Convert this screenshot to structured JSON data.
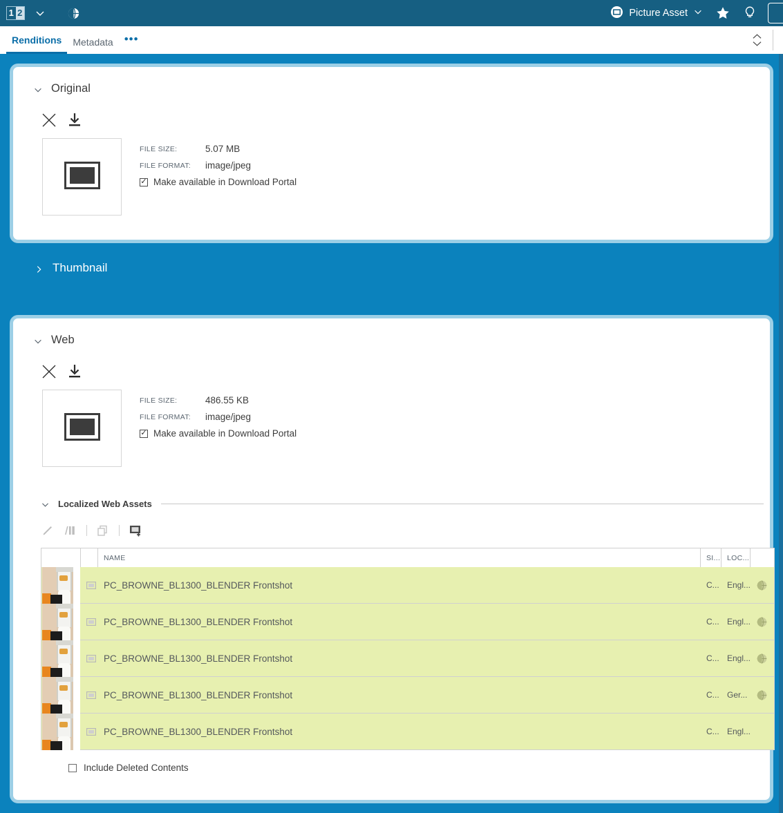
{
  "appbar": {
    "logo_first": "1",
    "logo_second": "2",
    "dropdown_icon": "chevron-down-icon",
    "globe_icon": "globe-icon",
    "asset_type_label": "Picture Asset",
    "asset_type_icon": "picture-icon",
    "asset_type_chevron": "chevron-down-icon",
    "favorite_icon": "star-icon",
    "hint_icon": "lightbulb-icon",
    "bar_color": "#165f82"
  },
  "tabs": {
    "items": [
      {
        "label": "Renditions",
        "active": true
      },
      {
        "label": "Metadata",
        "active": false
      }
    ],
    "more_label": "•••",
    "collapse_toggle_icon": "chevron-up-down-icon",
    "active_color": "#0b6ea8"
  },
  "background_color": "#0b82bd",
  "panel_border_color": "#9ccfe6",
  "renditions": {
    "original": {
      "title": "Original",
      "expanded": true,
      "chevron_icon": "chevron-down-icon",
      "delete_icon": "close-x-icon",
      "download_icon": "download-icon",
      "preview_icon": "picture-placeholder-icon",
      "file_size_label": "FILE SIZE:",
      "file_size_value": "5.07 MB",
      "file_format_label": "FILE FORMAT:",
      "file_format_value": "image/jpeg",
      "portal_label": "Make available in Download Portal",
      "portal_checked": true
    },
    "thumbnail": {
      "title": "Thumbnail",
      "expanded": false,
      "chevron_icon": "chevron-right-icon"
    },
    "web": {
      "title": "Web",
      "expanded": true,
      "chevron_icon": "chevron-down-icon",
      "delete_icon": "close-x-icon",
      "download_icon": "download-icon",
      "preview_icon": "picture-placeholder-icon",
      "file_size_label": "FILE SIZE:",
      "file_size_value": "486.55 KB",
      "file_format_label": "FILE FORMAT:",
      "file_format_value": "image/jpeg",
      "portal_label": "Make available in Download Portal",
      "portal_checked": true
    }
  },
  "localized_web_assets": {
    "title": "Localized Web Assets",
    "chevron_icon": "chevron-down-icon",
    "toolbar": [
      {
        "name": "edit-pencil-icon",
        "label": "Edit",
        "enabled": false
      },
      {
        "name": "compare-columns-icon",
        "label": "Compare",
        "enabled": false
      },
      {
        "name": "copy-icon",
        "label": "Copy",
        "enabled": false
      },
      {
        "name": "add-image-icon",
        "label": "Add Image",
        "enabled": true
      }
    ],
    "columns": [
      {
        "key": "thumb",
        "header": ""
      },
      {
        "key": "icon",
        "header": ""
      },
      {
        "key": "name",
        "header": "NAME"
      },
      {
        "key": "size",
        "header": "SI..."
      },
      {
        "key": "locale",
        "header": "LOC..."
      },
      {
        "key": "globe",
        "header": ""
      }
    ],
    "rows": [
      {
        "thumbnail": "blender-product-thumb",
        "type_icon": "picture-icon",
        "name": "PC_BROWNE_BL1300_BLENDER Frontshot",
        "size": "C...",
        "locale": "Engl...",
        "globe": true
      },
      {
        "thumbnail": "blender-product-thumb",
        "type_icon": "picture-icon",
        "name": "PC_BROWNE_BL1300_BLENDER Frontshot",
        "size": "C...",
        "locale": "Engl...",
        "globe": true
      },
      {
        "thumbnail": "blender-product-thumb",
        "type_icon": "picture-icon",
        "name": "PC_BROWNE_BL1300_BLENDER Frontshot",
        "size": "C...",
        "locale": "Engl...",
        "globe": true
      },
      {
        "thumbnail": "blender-product-thumb",
        "type_icon": "picture-icon",
        "name": "PC_BROWNE_BL1300_BLENDER Frontshot",
        "size": "C...",
        "locale": "Ger...",
        "globe": true
      },
      {
        "thumbnail": "blender-product-thumb",
        "type_icon": "picture-icon",
        "name": "PC_BROWNE_BL1300_BLENDER Frontshot",
        "size": "C...",
        "locale": "Engl...",
        "globe": false
      }
    ],
    "row_highlight_color": "#e7f0b0",
    "include_deleted_label": "Include Deleted Contents",
    "include_deleted_checked": false
  }
}
